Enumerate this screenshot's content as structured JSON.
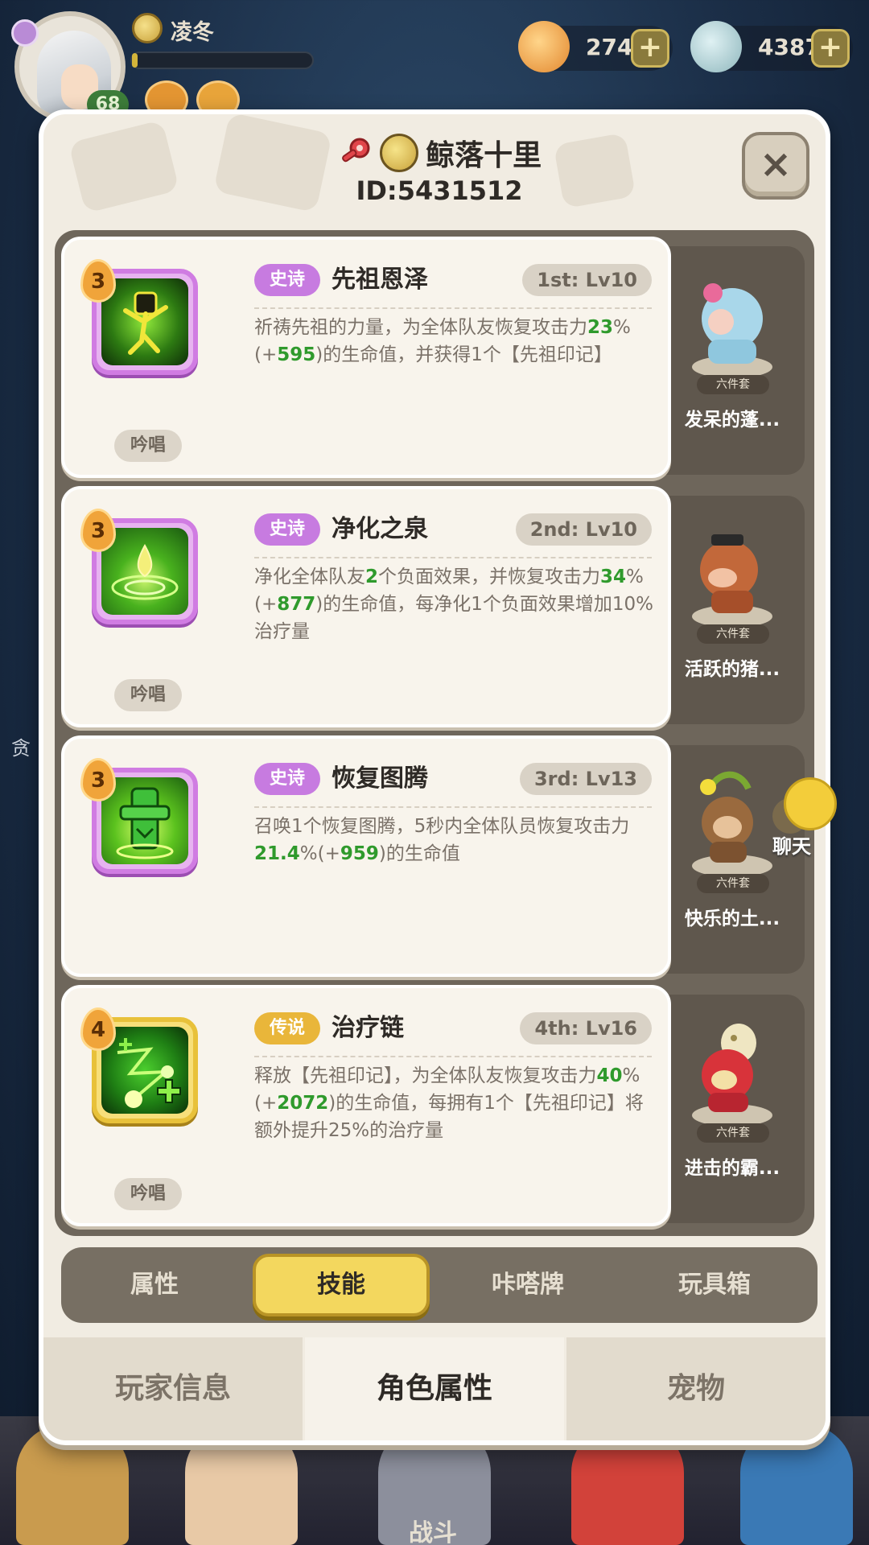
{
  "hud": {
    "player_name": "凌冬",
    "level": "68",
    "xp_fraction": 0.03,
    "currency1": "274",
    "currency2": "4387",
    "plus_symbol": "+"
  },
  "panel": {
    "player_title": "鲸落十里",
    "player_id": "ID:5431512",
    "close_symbol": "×"
  },
  "skills": [
    {
      "badge": "3",
      "rarity": "史诗",
      "rarity_type": "epic",
      "name": "先祖恩泽",
      "slot": "1st: Lv10",
      "desc_a": "祈祷先祖的力量，为全体队友恢复攻击力",
      "desc_b": "23",
      "desc_c": "%(+",
      "desc_d": "595",
      "desc_e": ")的生命值，并获得1个【先祖印记】",
      "chant": "吟唱",
      "pet_tag": "六件套",
      "pet_name": "发呆的蓬..."
    },
    {
      "badge": "3",
      "rarity": "史诗",
      "rarity_type": "epic",
      "name": "净化之泉",
      "slot": "2nd: Lv10",
      "desc_a": "净化全体队友",
      "desc_b": "2",
      "desc_c": "个负面效果，并恢复攻击力",
      "desc_d": "34",
      "desc_e": "%(+",
      "desc_f": "877",
      "desc_g": ")的生命值，每净化1个负面效果增加10%治疗量",
      "chant": "吟唱",
      "pet_tag": "六件套",
      "pet_name": "活跃的猪..."
    },
    {
      "badge": "3",
      "rarity": "史诗",
      "rarity_type": "epic",
      "name": "恢复图腾",
      "slot": "3rd: Lv13",
      "desc_a": "召唤1个恢复图腾，5秒内全体队员恢复攻击力",
      "desc_b": "21.4",
      "desc_c": "%(+",
      "desc_d": "959",
      "desc_e": ")的生命值",
      "pet_tag": "六件套",
      "pet_name": "快乐的土..."
    },
    {
      "badge": "4",
      "rarity": "传说",
      "rarity_type": "legend",
      "name": "治疗链",
      "slot": "4th: Lv16",
      "desc_a": "释放【先祖印记】，为全体队友恢复攻击力",
      "desc_b": "40",
      "desc_c": "%(+",
      "desc_d": "2072",
      "desc_e": ")的生命值，每拥有1个【先祖印记】将额外提升25%的治疗量",
      "chant": "吟唱",
      "pet_tag": "六件套",
      "pet_name": "进击的霸..."
    }
  ],
  "chat_label": "聊天",
  "sub_tabs": [
    "属性",
    "技能",
    "咔嗒牌",
    "玩具箱"
  ],
  "bottom_tabs": [
    "玩家信息",
    "角色属性",
    "宠物"
  ],
  "battle_label": "战斗",
  "side_text": "贪",
  "colors": {
    "epic": "#c77be0",
    "legend": "#e9b63a",
    "highlight_green": "#2f9a2c",
    "active_tab": "#f3d75e"
  }
}
